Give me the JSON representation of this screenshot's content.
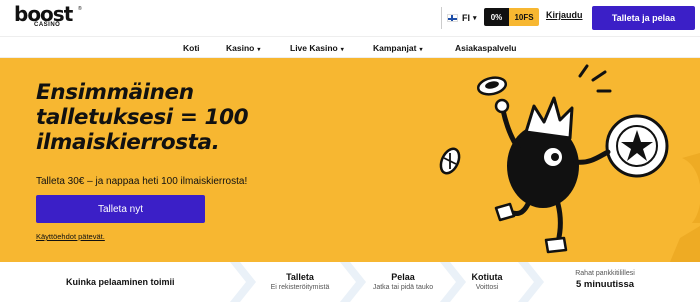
{
  "logo": {
    "main": "boost",
    "sub": "CASINO",
    "mark": "®"
  },
  "header": {
    "lang_code": "FI",
    "balance_money": "0%",
    "balance_spins": "10FS",
    "logout_label": "Kirjaudu",
    "deposit_label": "Talleta ja pelaa"
  },
  "nav": {
    "items": [
      {
        "label": "Koti",
        "caret": false
      },
      {
        "label": "Kasino",
        "caret": true
      },
      {
        "label": "Live Kasino",
        "caret": true
      },
      {
        "label": "Kampanjat",
        "caret": true
      },
      {
        "label": "Asiakaspalvelu",
        "caret": false
      }
    ]
  },
  "hero": {
    "title_line1": "Ensimmäinen",
    "title_line2": "talletuksesi = 100",
    "title_line3": "ilmaiskierrosta.",
    "subtitle": "Talleta 30€ – ja nappaa heti 100 ilmaiskierrosta!",
    "cta_label": "Talleta nyt",
    "terms_label": "Käyttöehdot pätevät."
  },
  "steps": {
    "heading": "Kuinka pelaaminen toimii",
    "items": [
      {
        "title": "Talleta",
        "subtitle": "Ei rekisteröitymistä"
      },
      {
        "title": "Pelaa",
        "subtitle": "Jatka tai pidä tauko"
      },
      {
        "title": "Kotiuta",
        "subtitle": "Voittosi"
      }
    ],
    "payout_label": "Rahat pankkitilillesi",
    "payout_value": "5 minuutissa"
  },
  "colors": {
    "brand_yellow": "#f7b731",
    "brand_purple": "#3b1fc7",
    "ink": "#111111"
  }
}
